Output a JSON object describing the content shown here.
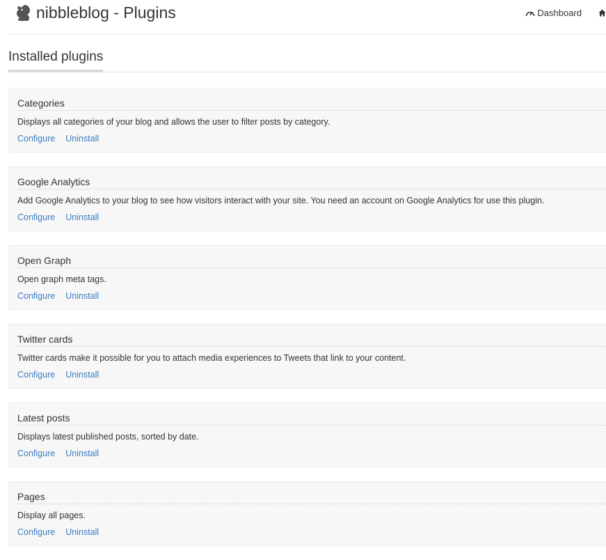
{
  "header": {
    "logo_icon": "squirrel-logo-icon",
    "title": "nibbleblog - Plugins",
    "nav": {
      "dashboard_label": "Dashboard",
      "dashboard_icon": "speedometer-icon",
      "home_icon": "home-icon"
    }
  },
  "main": {
    "section_title": "Installed plugins",
    "plugins": [
      {
        "name": "Categories",
        "description": "Displays all categories of your blog and allows the user to filter posts by category.",
        "configure_label": "Configure",
        "uninstall_label": "Uninstall"
      },
      {
        "name": "Google Analytics",
        "description": "Add Google Analytics to your blog to see how visitors interact with your site. You need an account on Google Analytics for use this plugin.",
        "configure_label": "Configure",
        "uninstall_label": "Uninstall"
      },
      {
        "name": "Open Graph",
        "description": "Open graph meta tags.",
        "configure_label": "Configure",
        "uninstall_label": "Uninstall"
      },
      {
        "name": "Twitter cards",
        "description": "Twitter cards make it possible for you to attach media experiences to Tweets that link to your content.",
        "configure_label": "Configure",
        "uninstall_label": "Uninstall"
      },
      {
        "name": "Latest posts",
        "description": "Displays latest published posts, sorted by date.",
        "configure_label": "Configure",
        "uninstall_label": "Uninstall"
      },
      {
        "name": "Pages",
        "description": "Display all pages.",
        "configure_label": "Configure",
        "uninstall_label": "Uninstall"
      }
    ]
  },
  "colors": {
    "link": "#3a7bbf",
    "text": "#333333",
    "card_background": "#f7f7f7"
  }
}
